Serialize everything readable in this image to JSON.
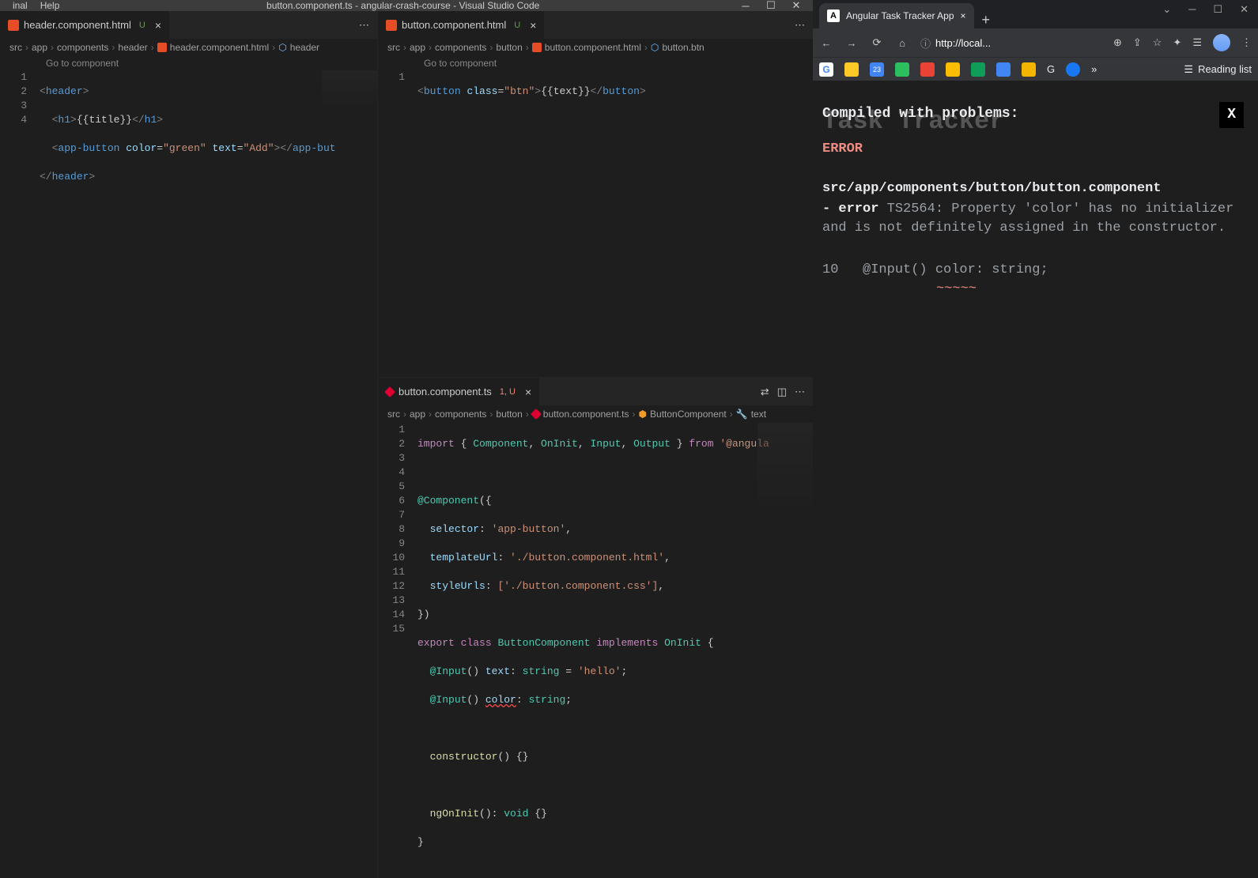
{
  "vscode": {
    "menubar": {
      "items": [
        "inal",
        "Help"
      ]
    },
    "window_title": "button.component.ts - angular-crash-course - Visual Studio Code",
    "left": {
      "tab": {
        "name": "header.component.html",
        "status": "U"
      },
      "breadcrumb": [
        "src",
        "app",
        "components",
        "header",
        "header.component.html",
        "header"
      ],
      "go_to": "Go to component",
      "code": {
        "lines": [
          1,
          2,
          3,
          4
        ],
        "l1": {
          "o": "<",
          "t": "header",
          "c": ">"
        },
        "l2": {
          "o": "<",
          "t": "h1",
          "c": ">",
          "tx": "{{title}}",
          "o2": "</",
          "c2": ">"
        },
        "l3": {
          "o": "<",
          "t": "app-button",
          "a1": "color",
          "v1": "\"green\"",
          "a2": "text",
          "v2": "\"Add\"",
          "c": "></",
          "c2": "app-but"
        },
        "l4": {
          "o": "</",
          "t": "header",
          "c": ">"
        }
      }
    },
    "rightTop": {
      "tab": {
        "name": "button.component.html",
        "status": "U"
      },
      "breadcrumb": [
        "src",
        "app",
        "components",
        "button",
        "button.component.html",
        "button.btn"
      ],
      "go_to": "Go to component",
      "code": {
        "line_no": "1",
        "l1": {
          "o": "<",
          "t": "button",
          "a": "class",
          "v": "\"btn\"",
          "c": ">",
          "tx": "{{text}}",
          "o2": "</",
          "c2": ">"
        }
      }
    },
    "rightBottom": {
      "tab": {
        "name": "button.component.ts",
        "status": "1, U"
      },
      "breadcrumb": [
        "src",
        "app",
        "components",
        "button",
        "button.component.ts",
        "ButtonComponent",
        "text"
      ],
      "code": {
        "lines": [
          1,
          2,
          3,
          4,
          5,
          6,
          7,
          8,
          9,
          10,
          11,
          12,
          13,
          14,
          15
        ],
        "l1": "import { Component, OnInit, Input, Output } from '@angula",
        "l3_deco": "@Component",
        "l3_rest": "({",
        "l4_k": "selector",
        "l4_v": "'app-button'",
        "l5_k": "templateUrl",
        "l5_v": "'./button.component.html'",
        "l6_k": "styleUrls",
        "l6_v": "['./button.component.css']",
        "l7": "})",
        "l8_export": "export",
        "l8_class": "class",
        "l8_name": "ButtonComponent",
        "l8_impl": "implements",
        "l8_oninit": "OnInit",
        "l8_b": " {",
        "l9_deco": "@Input",
        "l9_p": "text",
        "l9_t": "string",
        "l9_eq": " = ",
        "l9_v": "'hello'",
        "l10_deco": "@Input",
        "l10_p": "color",
        "l10_t": "string",
        "l12_fn": "constructor",
        "l12_b": "() {}",
        "l14_fn": "ngOnInit",
        "l14_sig": "(): ",
        "l14_void": "void",
        "l14_b": " {}",
        "l15": "}"
      }
    }
  },
  "browser": {
    "tab_title": "Angular Task Tracker App",
    "url_display": "http://local...",
    "reading_list": "Reading list",
    "overlay_text": "Task Tracker",
    "error": {
      "title": "Compiled with problems:",
      "label": "ERROR",
      "path": "src/app/components/button/button.component",
      "prefix": "- error",
      "code": "TS2564:",
      "msg": " Property 'color' has no initializer and is not definitely assigned in the constructor.",
      "line_no": "10",
      "line_code": "@Input() color: string;",
      "tilde": "~~~~~",
      "close": "X"
    }
  }
}
